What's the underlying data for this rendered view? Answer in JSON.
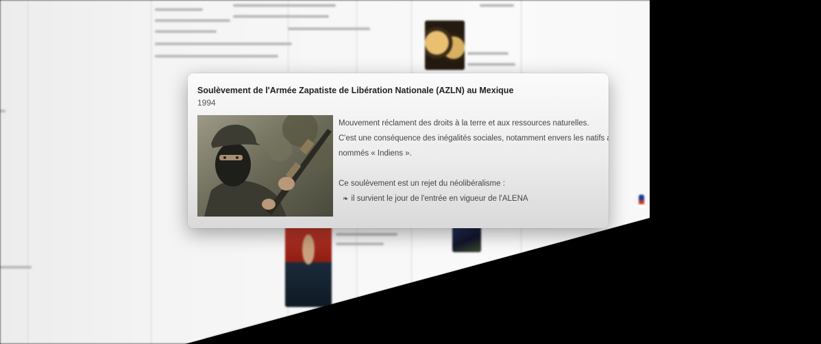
{
  "card": {
    "title": "Soulèvement de l'Armée Zapatiste de Libération Nationale (AZLN) au Mexique",
    "year": "1994",
    "paragraph1_line1": "Mouvement réclament des droits à la terre et aux ressources naturelles.",
    "paragraph1_line2": "C'est une conséquence des inégalités sociales, notamment envers les natifs américains,",
    "paragraph1_line3": "nommés « Indiens ».",
    "paragraph2": "Ce soulèvement est un rejet du néolibéralisme :",
    "bullet_symbol": "❧",
    "bullet_text": "il survient le jour de l'entrée en vigueur de l'ALENA",
    "photo_icon": "masked-rebel-photo"
  },
  "background": {
    "icons": [
      "portrait-thumbnail",
      "binocular-thumbnail",
      "dark-thumbnail",
      "faded-thumbnail",
      "flag-icon"
    ]
  },
  "colors": {
    "backdrop": "#000000",
    "sheet": "#f4f4f4",
    "card": "#ececec",
    "title_text": "#222222",
    "body_text": "#444444"
  }
}
